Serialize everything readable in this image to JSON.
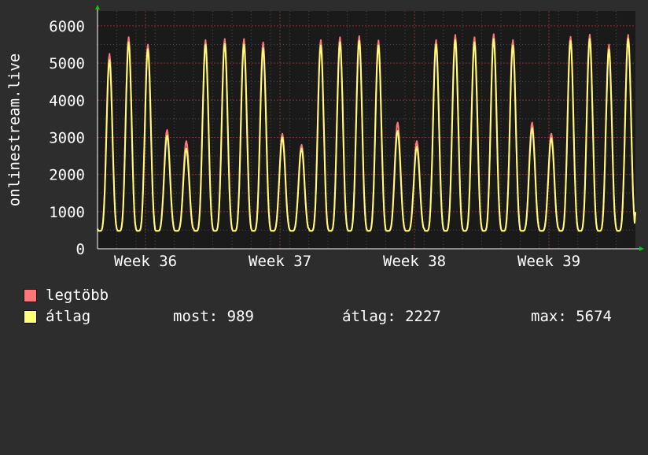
{
  "chart_data": {
    "type": "line",
    "ylabel": "onlinestream.live",
    "ylim": [
      0,
      6400
    ],
    "yticks": [
      0,
      1000,
      2000,
      3000,
      4000,
      5000,
      6000
    ],
    "xticks": [
      "Week 36",
      "Week 37",
      "Week 38",
      "Week 39"
    ],
    "grid": true,
    "background": "#1a1a1a",
    "grid_color": "#aa3333",
    "daily_peaks": [
      {
        "max": 5250,
        "avg": 5080
      },
      {
        "max": 5700,
        "avg": 5560
      },
      {
        "max": 5500,
        "avg": 5380
      },
      {
        "max": 3200,
        "avg": 3050
      },
      {
        "max": 2900,
        "avg": 2700
      },
      {
        "max": 5620,
        "avg": 5500
      },
      {
        "max": 5650,
        "avg": 5520
      },
      {
        "max": 5650,
        "avg": 5500
      },
      {
        "max": 5560,
        "avg": 5400
      },
      {
        "max": 3100,
        "avg": 3000
      },
      {
        "max": 2800,
        "avg": 2700
      },
      {
        "max": 5620,
        "avg": 5480
      },
      {
        "max": 5700,
        "avg": 5560
      },
      {
        "max": 5730,
        "avg": 5600
      },
      {
        "max": 5610,
        "avg": 5480
      },
      {
        "max": 3400,
        "avg": 3180
      },
      {
        "max": 2900,
        "avg": 2750
      },
      {
        "max": 5620,
        "avg": 5500
      },
      {
        "max": 5760,
        "avg": 5620
      },
      {
        "max": 5700,
        "avg": 5560
      },
      {
        "max": 5780,
        "avg": 5650
      },
      {
        "max": 5620,
        "avg": 5480
      },
      {
        "max": 3400,
        "avg": 3250
      },
      {
        "max": 3100,
        "avg": 2980
      },
      {
        "max": 5710,
        "avg": 5600
      },
      {
        "max": 5770,
        "avg": 5650
      },
      {
        "max": 5500,
        "avg": 5370
      },
      {
        "max": 5760,
        "avg": 5650
      }
    ],
    "daily_minimum": 480,
    "series": [
      {
        "name": "legtöbb",
        "color": "#ff7777"
      },
      {
        "name": "átlag",
        "color": "#ffff77"
      }
    ]
  },
  "legend": {
    "max_label": "legtöbb",
    "avg_label": "átlag",
    "now_label": "most: 989",
    "avg_stat_label": "átlag: 2227",
    "max_stat_label": "max: 5674"
  }
}
